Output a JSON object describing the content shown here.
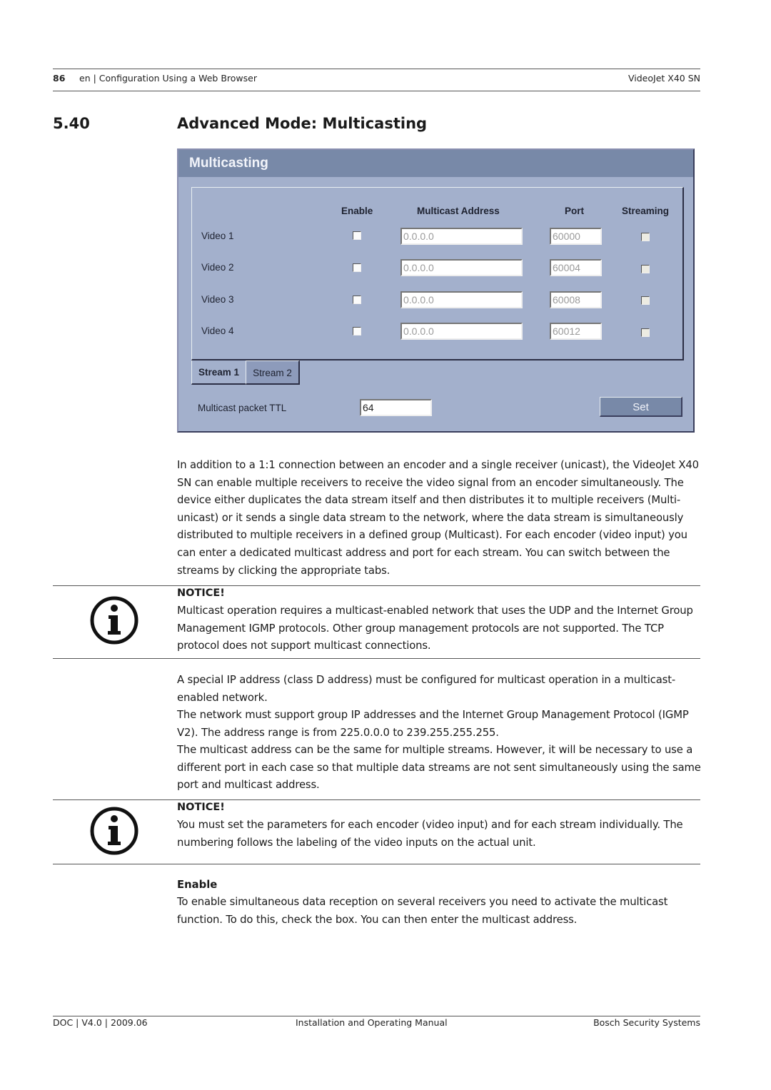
{
  "header": {
    "page_number": "86",
    "breadcrumb": "en | Configuration Using a Web Browser",
    "product": "VideoJet X40 SN"
  },
  "section": {
    "number": "5.40",
    "title": "Advanced Mode: Multicasting"
  },
  "ui": {
    "panel_title": "Multicasting",
    "columns": {
      "enable": "Enable",
      "address": "Multicast Address",
      "port": "Port",
      "streaming": "Streaming"
    },
    "rows": [
      {
        "label": "Video 1",
        "address": "0.0.0.0",
        "port": "60000",
        "enabled": false,
        "streaming": false
      },
      {
        "label": "Video 2",
        "address": "0.0.0.0",
        "port": "60004",
        "enabled": false,
        "streaming": false
      },
      {
        "label": "Video 3",
        "address": "0.0.0.0",
        "port": "60008",
        "enabled": false,
        "streaming": false
      },
      {
        "label": "Video 4",
        "address": "0.0.0.0",
        "port": "60012",
        "enabled": false,
        "streaming": false
      }
    ],
    "tabs": [
      {
        "label": "Stream 1",
        "active": true
      },
      {
        "label": "Stream 2",
        "active": false
      }
    ],
    "ttl_label": "Multicast packet TTL",
    "ttl_value": "64",
    "set_button": "Set",
    "colors": {
      "panel_bg": "#a3b0cc",
      "header_bg": "#7889a8",
      "button_bg": "#7889a8"
    }
  },
  "body": {
    "intro": "In addition to a 1:1 connection between an encoder and a single receiver (unicast), the VideoJet X40 SN can enable multiple receivers to receive the video signal from an encoder simultaneously. The device either duplicates the data stream itself and then distributes it to multiple receivers (Multi-unicast) or it sends a single data stream to the network, where the data stream is simultaneously distributed to multiple receivers in a defined group (Multicast). For each encoder (video input) you can enter a dedicated multicast address and port for each stream. You can switch between the streams by clicking the appropriate tabs.",
    "notice1": {
      "heading": "NOTICE!",
      "text": "Multicast operation requires a multicast-enabled network that uses the UDP and the Internet Group Management IGMP protocols. Other group management protocols are not supported. The TCP protocol does not support multicast connections."
    },
    "para2": [
      "A special IP address (class D address) must be configured for multicast operation in a multicast-enabled network.",
      "The network must support group IP addresses and the Internet Group Management Protocol (IGMP V2). The address range is from 225.0.0.0 to 239.255.255.255.",
      "The multicast address can be the same for multiple streams. However, it will be necessary to use a different port in each case so that multiple data streams are not sent simultaneously using the same port and multicast address."
    ],
    "notice2": {
      "heading": "NOTICE!",
      "text": "You must set the parameters for each encoder (video input) and for each stream individually. The numbering follows the labeling of the video inputs on the actual unit."
    },
    "enable_heading": "Enable",
    "enable_text": "To enable simultaneous data reception on several receivers you need to activate the multicast function. To do this, check the box. You can then enter the multicast address."
  },
  "footer": {
    "left": "DOC | V4.0 | 2009.06",
    "center": "Installation and Operating Manual",
    "right": "Bosch Security Systems"
  }
}
